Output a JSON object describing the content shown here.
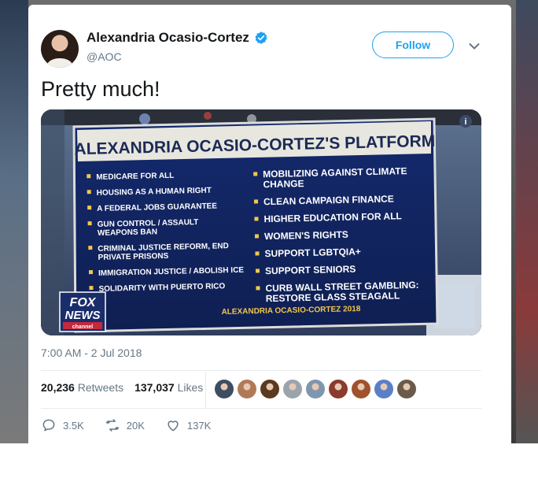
{
  "user": {
    "name": "Alexandria Ocasio-Cortez",
    "handle": "@AOC",
    "verified": true
  },
  "follow_label": "Follow",
  "tweet_text": "Pretty much!",
  "media": {
    "headline": "ALEXANDRIA OCASIO-CORTEZ'S PLATFORM",
    "left_items": [
      [
        "MEDICARE FOR ALL"
      ],
      [
        "HOUSING AS A HUMAN RIGHT"
      ],
      [
        "A FEDERAL JOBS GUARANTEE"
      ],
      [
        "GUN CONTROL / ASSAULT",
        "WEAPONS BAN"
      ],
      [
        "CRIMINAL JUSTICE REFORM, END",
        "PRIVATE PRISONS"
      ],
      [
        "IMMIGRATION JUSTICE / ABOLISH ICE"
      ],
      [
        "SOLIDARITY WITH PUERTO RICO"
      ]
    ],
    "right_items": [
      [
        "MOBILIZING AGAINST CLIMATE",
        "CHANGE"
      ],
      [
        "CLEAN CAMPAIGN FINANCE"
      ],
      [
        "HIGHER EDUCATION FOR ALL"
      ],
      [
        "WOMEN'S RIGHTS"
      ],
      [
        "SUPPORT LGBTQIA+"
      ],
      [
        "SUPPORT SENIORS"
      ],
      [
        "CURB WALL STREET GAMBLING:",
        "RESTORE GLASS STEAGALL"
      ]
    ],
    "footer": "ALEXANDRIA OCASIO-CORTEZ 2018",
    "logo_text": [
      "FOX",
      "NEWS",
      "channel"
    ]
  },
  "timestamp": "7:00 AM - 2 Jul 2018",
  "stats": {
    "retweets_count": "20,236",
    "retweets_label": "Retweets",
    "likes_count": "137,037",
    "likes_label": "Likes"
  },
  "liker_avatars": [
    {
      "color": "#3f4d63"
    },
    {
      "color": "#b07a56"
    },
    {
      "color": "#5b3a20"
    },
    {
      "color": "#9aa4ad"
    },
    {
      "color": "#7f97ad"
    },
    {
      "color": "#8a3b2b"
    },
    {
      "color": "#a0522d"
    },
    {
      "color": "#5b7fc7"
    },
    {
      "color": "#6b5a4a"
    }
  ],
  "actions": {
    "replies": "3.5K",
    "retweets": "20K",
    "likes": "137K"
  },
  "colors": {
    "accent": "#1da1f2",
    "text": "#14171a",
    "muted": "#657786",
    "screen_bg": "#1d2b55",
    "headline_bg": "#e8e7df"
  }
}
